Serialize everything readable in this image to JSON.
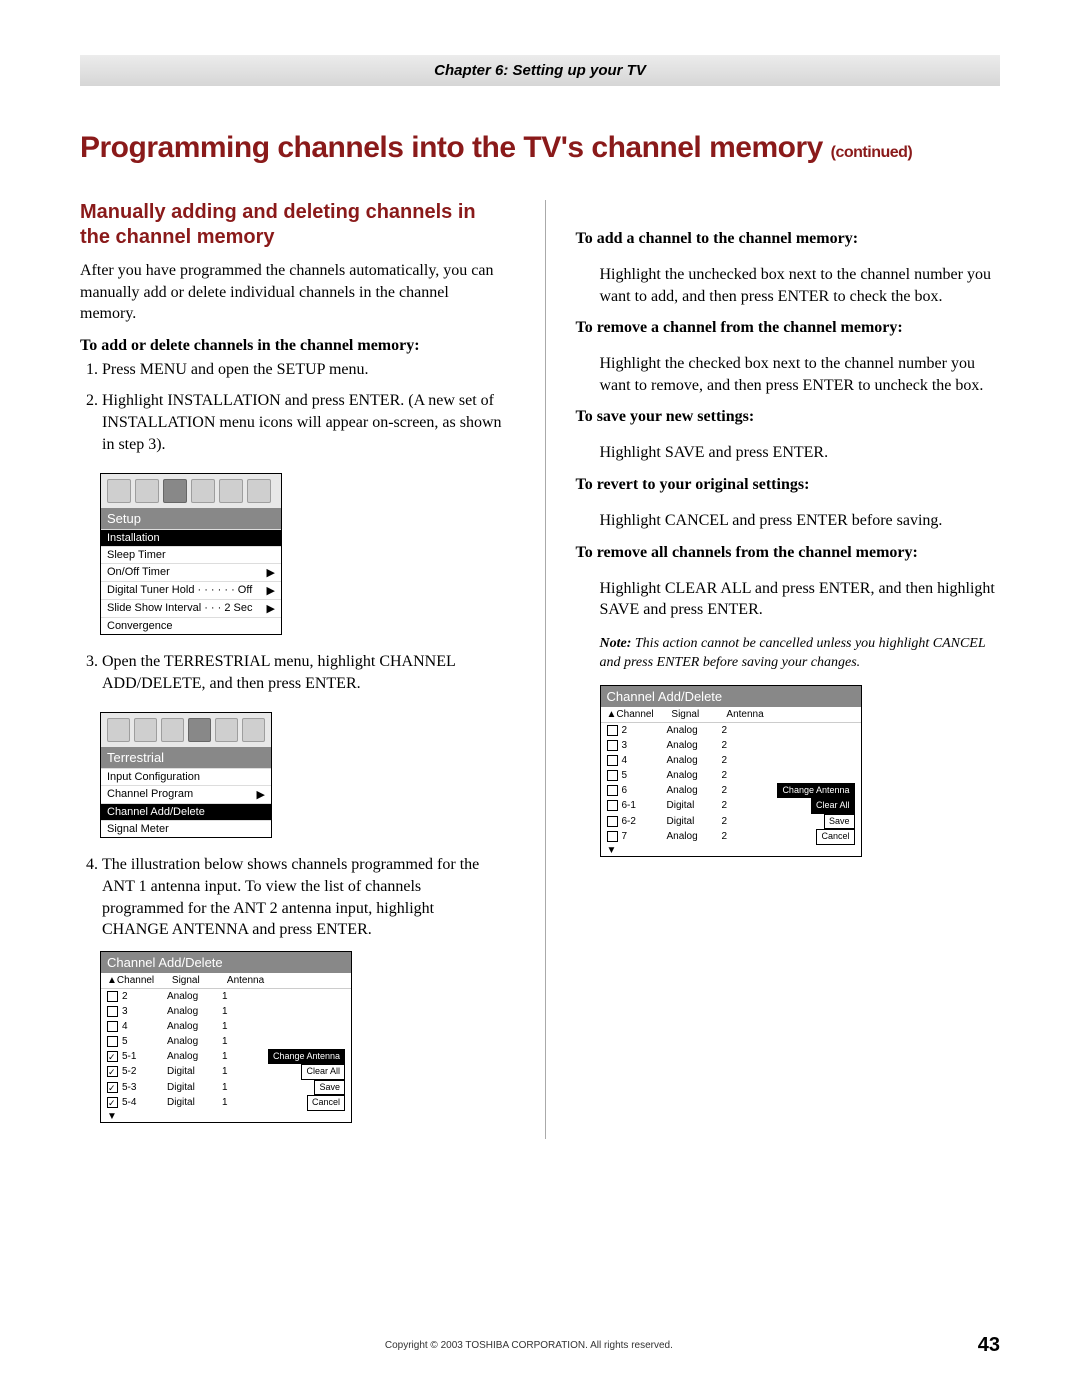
{
  "chapter_bar": "Chapter 6: Setting up your TV",
  "main_title": "Programming channels into the TV's channel memory",
  "main_title_cont": "(continued)",
  "sub_heading": "Manually adding and deleting channels in the channel memory",
  "intro": "After you have programmed the channels automatically, you can manually add or delete individual channels in the channel memory.",
  "label_add_delete": "To add or delete channels in the channel memory:",
  "step1": "Press MENU and open the SETUP menu.",
  "step2": "Highlight INSTALLATION and press ENTER. (A new set of INSTALLATION menu icons will appear on-screen, as shown in step 3).",
  "osd_setup": {
    "title": "Setup",
    "items": [
      {
        "label": "Installation",
        "hl": true
      },
      {
        "label": "Sleep Timer"
      },
      {
        "label": "On/Off Timer"
      },
      {
        "label": "Digital Tuner Hold · · · · · · Off"
      },
      {
        "label": "Slide Show Interval · · · 2 Sec"
      },
      {
        "label": "Convergence"
      }
    ]
  },
  "step3": "Open the TERRESTRIAL menu, highlight CHANNEL ADD/DELETE, and then press ENTER.",
  "osd_terr": {
    "title": "Terrestrial",
    "items": [
      {
        "label": "Input Configuration"
      },
      {
        "label": "Channel Program",
        "arrow": true
      },
      {
        "label": "Channel Add/Delete",
        "hl": true
      },
      {
        "label": "Signal Meter"
      }
    ]
  },
  "step4": "The illustration below shows channels programmed for the ANT 1 antenna input. To view the list of channels programmed for the ANT 2 antenna input, highlight CHANGE ANTENNA and press ENTER.",
  "cad1": {
    "title": "Channel Add/Delete",
    "head": {
      "c1": "Channel",
      "c2": "Signal",
      "c3": "Antenna"
    },
    "rows": [
      {
        "ck": false,
        "ch": "2",
        "sig": "Analog",
        "ant": "1"
      },
      {
        "ck": false,
        "ch": "3",
        "sig": "Analog",
        "ant": "1"
      },
      {
        "ck": false,
        "ch": "4",
        "sig": "Analog",
        "ant": "1"
      },
      {
        "ck": false,
        "ch": "5",
        "sig": "Analog",
        "ant": "1"
      },
      {
        "ck": true,
        "ch": "5-1",
        "sig": "Analog",
        "ant": "1",
        "btn": "Change Antenna",
        "hl": true
      },
      {
        "ck": true,
        "ch": "5-2",
        "sig": "Digital",
        "ant": "1",
        "btn": "Clear All"
      },
      {
        "ck": true,
        "ch": "5-3",
        "sig": "Digital",
        "ant": "1",
        "btn": "Save"
      },
      {
        "ck": true,
        "ch": "5-4",
        "sig": "Digital",
        "ant": "1",
        "btn": "Cancel"
      }
    ]
  },
  "right": {
    "label_add": "To add a channel to the channel memory:",
    "add_text": "Highlight the unchecked box next to the channel number you want to add, and then press ENTER to check the box.",
    "label_remove": "To remove a channel from the channel memory:",
    "remove_text": "Highlight the checked box next to the channel number you want to remove, and then press ENTER to uncheck the box.",
    "label_save": "To save your new settings:",
    "save_text": "Highlight SAVE and press ENTER.",
    "label_revert": "To revert to your original settings:",
    "revert_text": "Highlight CANCEL and press ENTER before saving.",
    "label_removeall": "To remove all channels from the channel memory:",
    "removeall_text": "Highlight CLEAR ALL and press ENTER, and then highlight SAVE and press ENTER.",
    "note_label": "Note:",
    "note_text": " This action cannot be cancelled unless you highlight CANCEL and press ENTER before saving your changes."
  },
  "cad2": {
    "title": "Channel Add/Delete",
    "head": {
      "c1": "Channel",
      "c2": "Signal",
      "c3": "Antenna"
    },
    "rows": [
      {
        "ck": false,
        "ch": "2",
        "sig": "Analog",
        "ant": "2"
      },
      {
        "ck": false,
        "ch": "3",
        "sig": "Analog",
        "ant": "2"
      },
      {
        "ck": false,
        "ch": "4",
        "sig": "Analog",
        "ant": "2"
      },
      {
        "ck": false,
        "ch": "5",
        "sig": "Analog",
        "ant": "2"
      },
      {
        "ck": false,
        "ch": "6",
        "sig": "Analog",
        "ant": "2",
        "btn": "Change Antenna",
        "hl": true
      },
      {
        "ck": false,
        "ch": "6-1",
        "sig": "Digital",
        "ant": "2",
        "btn": "Clear All",
        "btnhl": true
      },
      {
        "ck": false,
        "ch": "6-2",
        "sig": "Digital",
        "ant": "2",
        "btn": "Save"
      },
      {
        "ck": false,
        "ch": "7",
        "sig": "Analog",
        "ant": "2",
        "btn": "Cancel"
      }
    ]
  },
  "copyright": "Copyright © 2003 TOSHIBA CORPORATION. All rights reserved.",
  "page_no": "43"
}
